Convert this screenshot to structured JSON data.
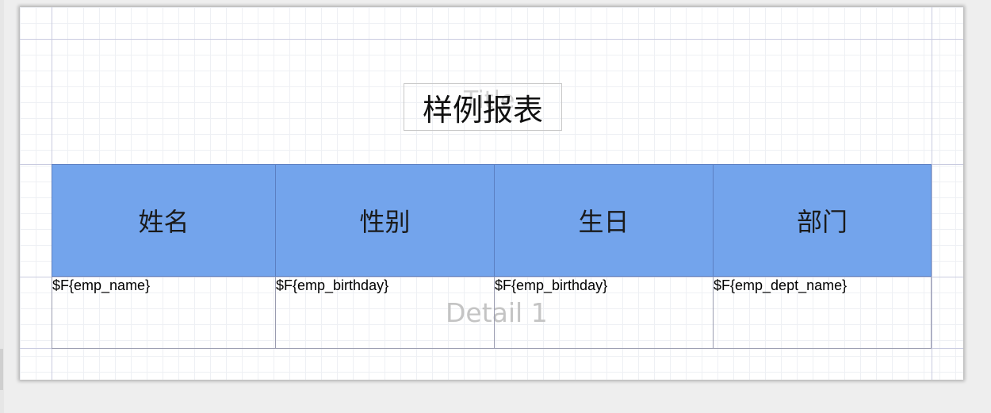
{
  "report": {
    "title": "样例报表",
    "title_band_label": "Title",
    "detail_band_label": "Detail 1",
    "columns": [
      {
        "header": "姓名",
        "field": "$F{emp_name}"
      },
      {
        "header": "性别",
        "field": "$F{emp_birthday}"
      },
      {
        "header": "生日",
        "field": "$F{emp_birthday}"
      },
      {
        "header": "部门",
        "field": "$F{emp_dept_name}"
      }
    ]
  },
  "colors": {
    "header_fill": "#73a4ec",
    "page_background": "#ffffff",
    "editor_background": "#eeeeee"
  }
}
